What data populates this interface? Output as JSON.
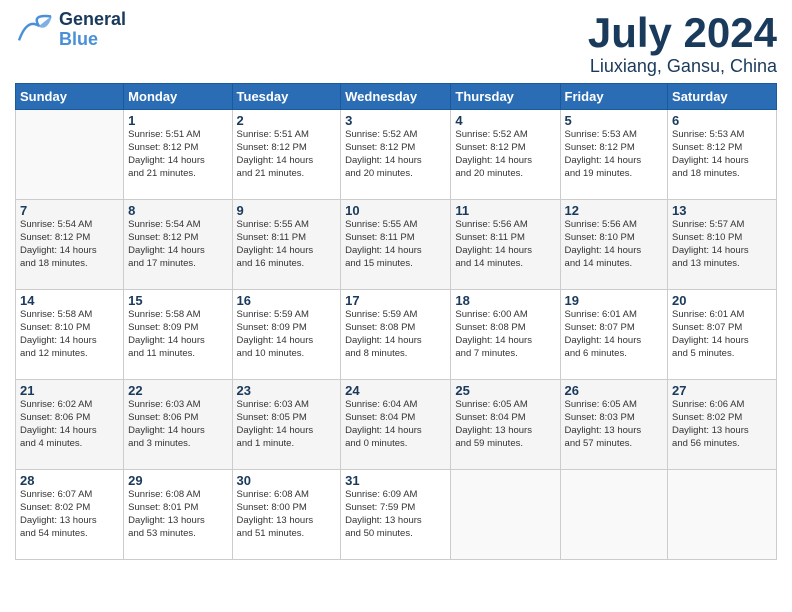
{
  "header": {
    "logo_general": "General",
    "logo_blue": "Blue",
    "title": "July 2024",
    "subtitle": "Liuxiang, Gansu, China"
  },
  "days_of_week": [
    "Sunday",
    "Monday",
    "Tuesday",
    "Wednesday",
    "Thursday",
    "Friday",
    "Saturday"
  ],
  "weeks": [
    [
      {
        "day": "",
        "info": ""
      },
      {
        "day": "1",
        "info": "Sunrise: 5:51 AM\nSunset: 8:12 PM\nDaylight: 14 hours\nand 21 minutes."
      },
      {
        "day": "2",
        "info": "Sunrise: 5:51 AM\nSunset: 8:12 PM\nDaylight: 14 hours\nand 21 minutes."
      },
      {
        "day": "3",
        "info": "Sunrise: 5:52 AM\nSunset: 8:12 PM\nDaylight: 14 hours\nand 20 minutes."
      },
      {
        "day": "4",
        "info": "Sunrise: 5:52 AM\nSunset: 8:12 PM\nDaylight: 14 hours\nand 20 minutes."
      },
      {
        "day": "5",
        "info": "Sunrise: 5:53 AM\nSunset: 8:12 PM\nDaylight: 14 hours\nand 19 minutes."
      },
      {
        "day": "6",
        "info": "Sunrise: 5:53 AM\nSunset: 8:12 PM\nDaylight: 14 hours\nand 18 minutes."
      }
    ],
    [
      {
        "day": "7",
        "info": ""
      },
      {
        "day": "8",
        "info": "Sunrise: 5:54 AM\nSunset: 8:12 PM\nDaylight: 14 hours\nand 17 minutes."
      },
      {
        "day": "9",
        "info": "Sunrise: 5:55 AM\nSunset: 8:11 PM\nDaylight: 14 hours\nand 16 minutes."
      },
      {
        "day": "10",
        "info": "Sunrise: 5:55 AM\nSunset: 8:11 PM\nDaylight: 14 hours\nand 15 minutes."
      },
      {
        "day": "11",
        "info": "Sunrise: 5:56 AM\nSunset: 8:11 PM\nDaylight: 14 hours\nand 14 minutes."
      },
      {
        "day": "12",
        "info": "Sunrise: 5:56 AM\nSunset: 8:10 PM\nDaylight: 14 hours\nand 14 minutes."
      },
      {
        "day": "13",
        "info": "Sunrise: 5:57 AM\nSunset: 8:10 PM\nDaylight: 14 hours\nand 13 minutes."
      }
    ],
    [
      {
        "day": "14",
        "info": ""
      },
      {
        "day": "15",
        "info": "Sunrise: 5:58 AM\nSunset: 8:09 PM\nDaylight: 14 hours\nand 11 minutes."
      },
      {
        "day": "16",
        "info": "Sunrise: 5:59 AM\nSunset: 8:09 PM\nDaylight: 14 hours\nand 10 minutes."
      },
      {
        "day": "17",
        "info": "Sunrise: 5:59 AM\nSunset: 8:08 PM\nDaylight: 14 hours\nand 8 minutes."
      },
      {
        "day": "18",
        "info": "Sunrise: 6:00 AM\nSunset: 8:08 PM\nDaylight: 14 hours\nand 7 minutes."
      },
      {
        "day": "19",
        "info": "Sunrise: 6:01 AM\nSunset: 8:07 PM\nDaylight: 14 hours\nand 6 minutes."
      },
      {
        "day": "20",
        "info": "Sunrise: 6:01 AM\nSunset: 8:07 PM\nDaylight: 14 hours\nand 5 minutes."
      }
    ],
    [
      {
        "day": "21",
        "info": ""
      },
      {
        "day": "22",
        "info": "Sunrise: 6:03 AM\nSunset: 8:06 PM\nDaylight: 14 hours\nand 3 minutes."
      },
      {
        "day": "23",
        "info": "Sunrise: 6:03 AM\nSunset: 8:05 PM\nDaylight: 14 hours\nand 1 minute."
      },
      {
        "day": "24",
        "info": "Sunrise: 6:04 AM\nSunset: 8:04 PM\nDaylight: 14 hours\nand 0 minutes."
      },
      {
        "day": "25",
        "info": "Sunrise: 6:05 AM\nSunset: 8:04 PM\nDaylight: 13 hours\nand 59 minutes."
      },
      {
        "day": "26",
        "info": "Sunrise: 6:05 AM\nSunset: 8:03 PM\nDaylight: 13 hours\nand 57 minutes."
      },
      {
        "day": "27",
        "info": "Sunrise: 6:06 AM\nSunset: 8:02 PM\nDaylight: 13 hours\nand 56 minutes."
      }
    ],
    [
      {
        "day": "28",
        "info": "Sunrise: 6:07 AM\nSunset: 8:02 PM\nDaylight: 13 hours\nand 54 minutes."
      },
      {
        "day": "29",
        "info": "Sunrise: 6:08 AM\nSunset: 8:01 PM\nDaylight: 13 hours\nand 53 minutes."
      },
      {
        "day": "30",
        "info": "Sunrise: 6:08 AM\nSunset: 8:00 PM\nDaylight: 13 hours\nand 51 minutes."
      },
      {
        "day": "31",
        "info": "Sunrise: 6:09 AM\nSunset: 7:59 PM\nDaylight: 13 hours\nand 50 minutes."
      },
      {
        "day": "",
        "info": ""
      },
      {
        "day": "",
        "info": ""
      },
      {
        "day": "",
        "info": ""
      }
    ]
  ],
  "week1_special": {
    "7": "Sunrise: 5:54 AM\nSunset: 8:12 PM\nDaylight: 14 hours\nand 18 minutes.",
    "14": "Sunrise: 5:58 AM\nSunset: 8:10 PM\nDaylight: 14 hours\nand 12 minutes.",
    "21": "Sunrise: 6:02 AM\nSunset: 8:06 PM\nDaylight: 14 hours\nand 4 minutes."
  }
}
